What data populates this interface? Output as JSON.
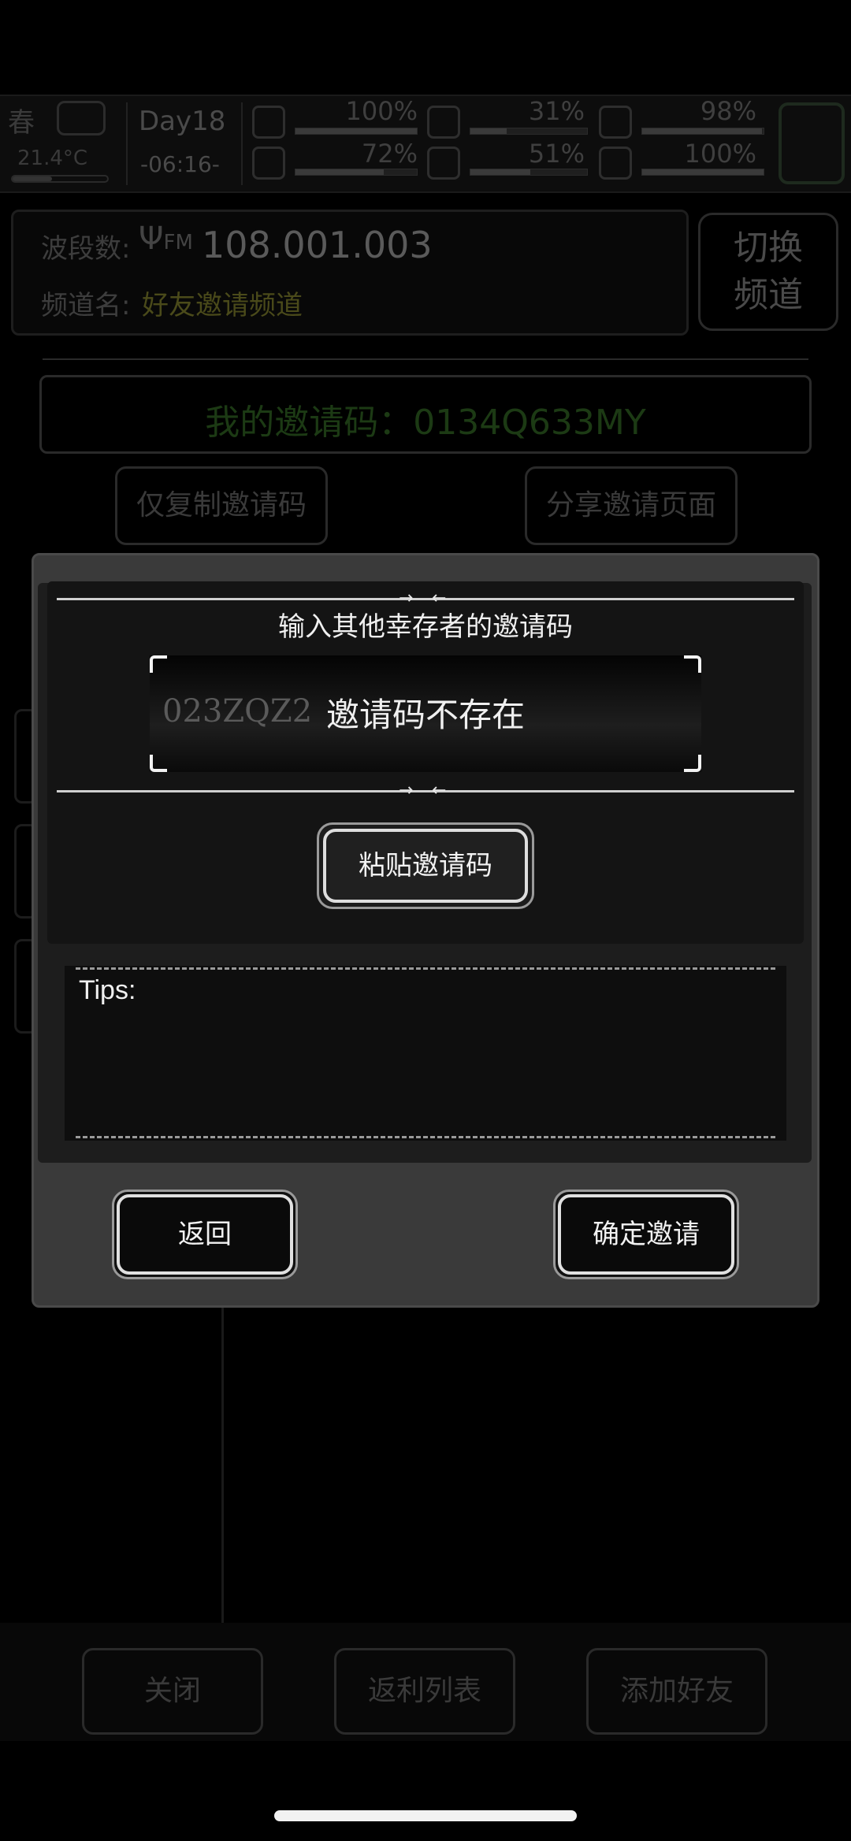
{
  "status": {
    "season": "春",
    "temperature": "21.4°C",
    "day": "Day18",
    "time": "-06:16-",
    "stats": [
      {
        "icon": "medkit-icon",
        "percent": "100%",
        "level": 1.0
      },
      {
        "icon": "stomach-icon",
        "percent": "31%",
        "level": 0.31
      },
      {
        "icon": "pill-icon",
        "percent": "98%",
        "level": 0.98
      },
      {
        "icon": "boot-icon",
        "percent": "72%",
        "level": 0.72
      },
      {
        "icon": "water-drop-icon",
        "percent": "51%",
        "level": 0.51
      },
      {
        "icon": "heart-icon",
        "percent": "100%",
        "level": 1.0
      }
    ]
  },
  "radio": {
    "band_label": "波段数:",
    "band_icon": "antenna-icon",
    "fm": "FM",
    "frequency": "108.001.003",
    "channel_label": "频道名:",
    "channel_name": "好友邀请频道",
    "switch_button": "切换\n频道",
    "my_code_label": "我的邀请码：",
    "my_code": "0134Q633MY",
    "copy_button": "仅复制邀请码",
    "share_button": "分享邀请页面"
  },
  "bottom_buttons": {
    "close": "关闭",
    "back_list": "返利列表",
    "add_friend": "添加好友"
  },
  "dialog": {
    "prompt": "输入其他幸存者的邀请码",
    "input_value": "023ZQZ2",
    "error_message": "邀请码不存在",
    "paste_button": "粘贴邀请码",
    "tips_label": "Tips:",
    "back_button": "返回",
    "confirm_button": "确定邀请"
  }
}
